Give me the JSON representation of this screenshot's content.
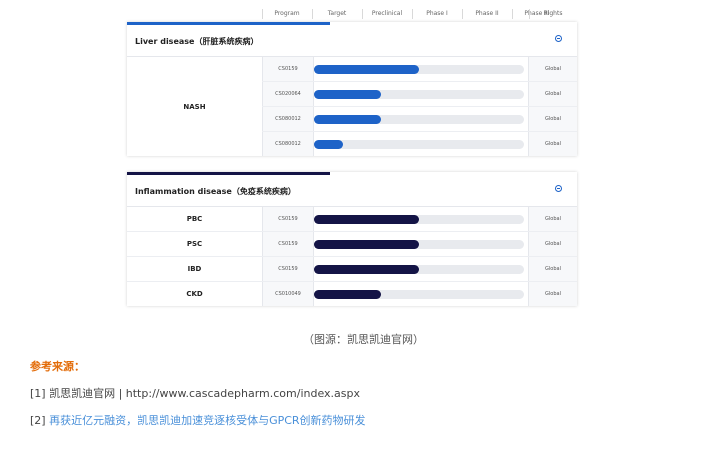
{
  "columns": [
    "Program",
    "Target",
    "Preclinical",
    "Phase I",
    "Phase II",
    "Phase III",
    "Rights"
  ],
  "liver": {
    "title": "Liver disease（肝脏系统疾病）",
    "accent": "#1e63c8",
    "disease": "NASH",
    "rows": [
      {
        "code": "CS0159",
        "progress": 0.5,
        "rights": "Global"
      },
      {
        "code": "CS020064",
        "progress": 0.32,
        "rights": "Global"
      },
      {
        "code": "CS080012",
        "progress": 0.32,
        "rights": "Global"
      },
      {
        "code": "CS080012",
        "progress": 0.14,
        "rights": "Global"
      }
    ]
  },
  "inflammation": {
    "title": "Inflammation disease（免疫系统疾病）",
    "accent": "#141446",
    "rows": [
      {
        "disease": "PBC",
        "code": "CS0159",
        "progress": 0.5,
        "rights": "Global"
      },
      {
        "disease": "PSC",
        "code": "CS0159",
        "progress": 0.5,
        "rights": "Global"
      },
      {
        "disease": "IBD",
        "code": "CS0159",
        "progress": 0.5,
        "rights": "Global"
      },
      {
        "disease": "CKD",
        "code": "CS010049",
        "progress": 0.32,
        "rights": "Global"
      }
    ]
  },
  "caption": "（图源：凯思凯迪官网）",
  "references_title": "参考来源：",
  "references": [
    {
      "prefix": "[1] ",
      "text": "凯思凯迪官网 | http://www.cascadepharm.com/index.aspx",
      "link": false
    },
    {
      "prefix": "[2] ",
      "text": "再获近亿元融资，凯思凯迪加速竞逐核受体与GPCR创新药物研发",
      "link": true
    }
  ]
}
